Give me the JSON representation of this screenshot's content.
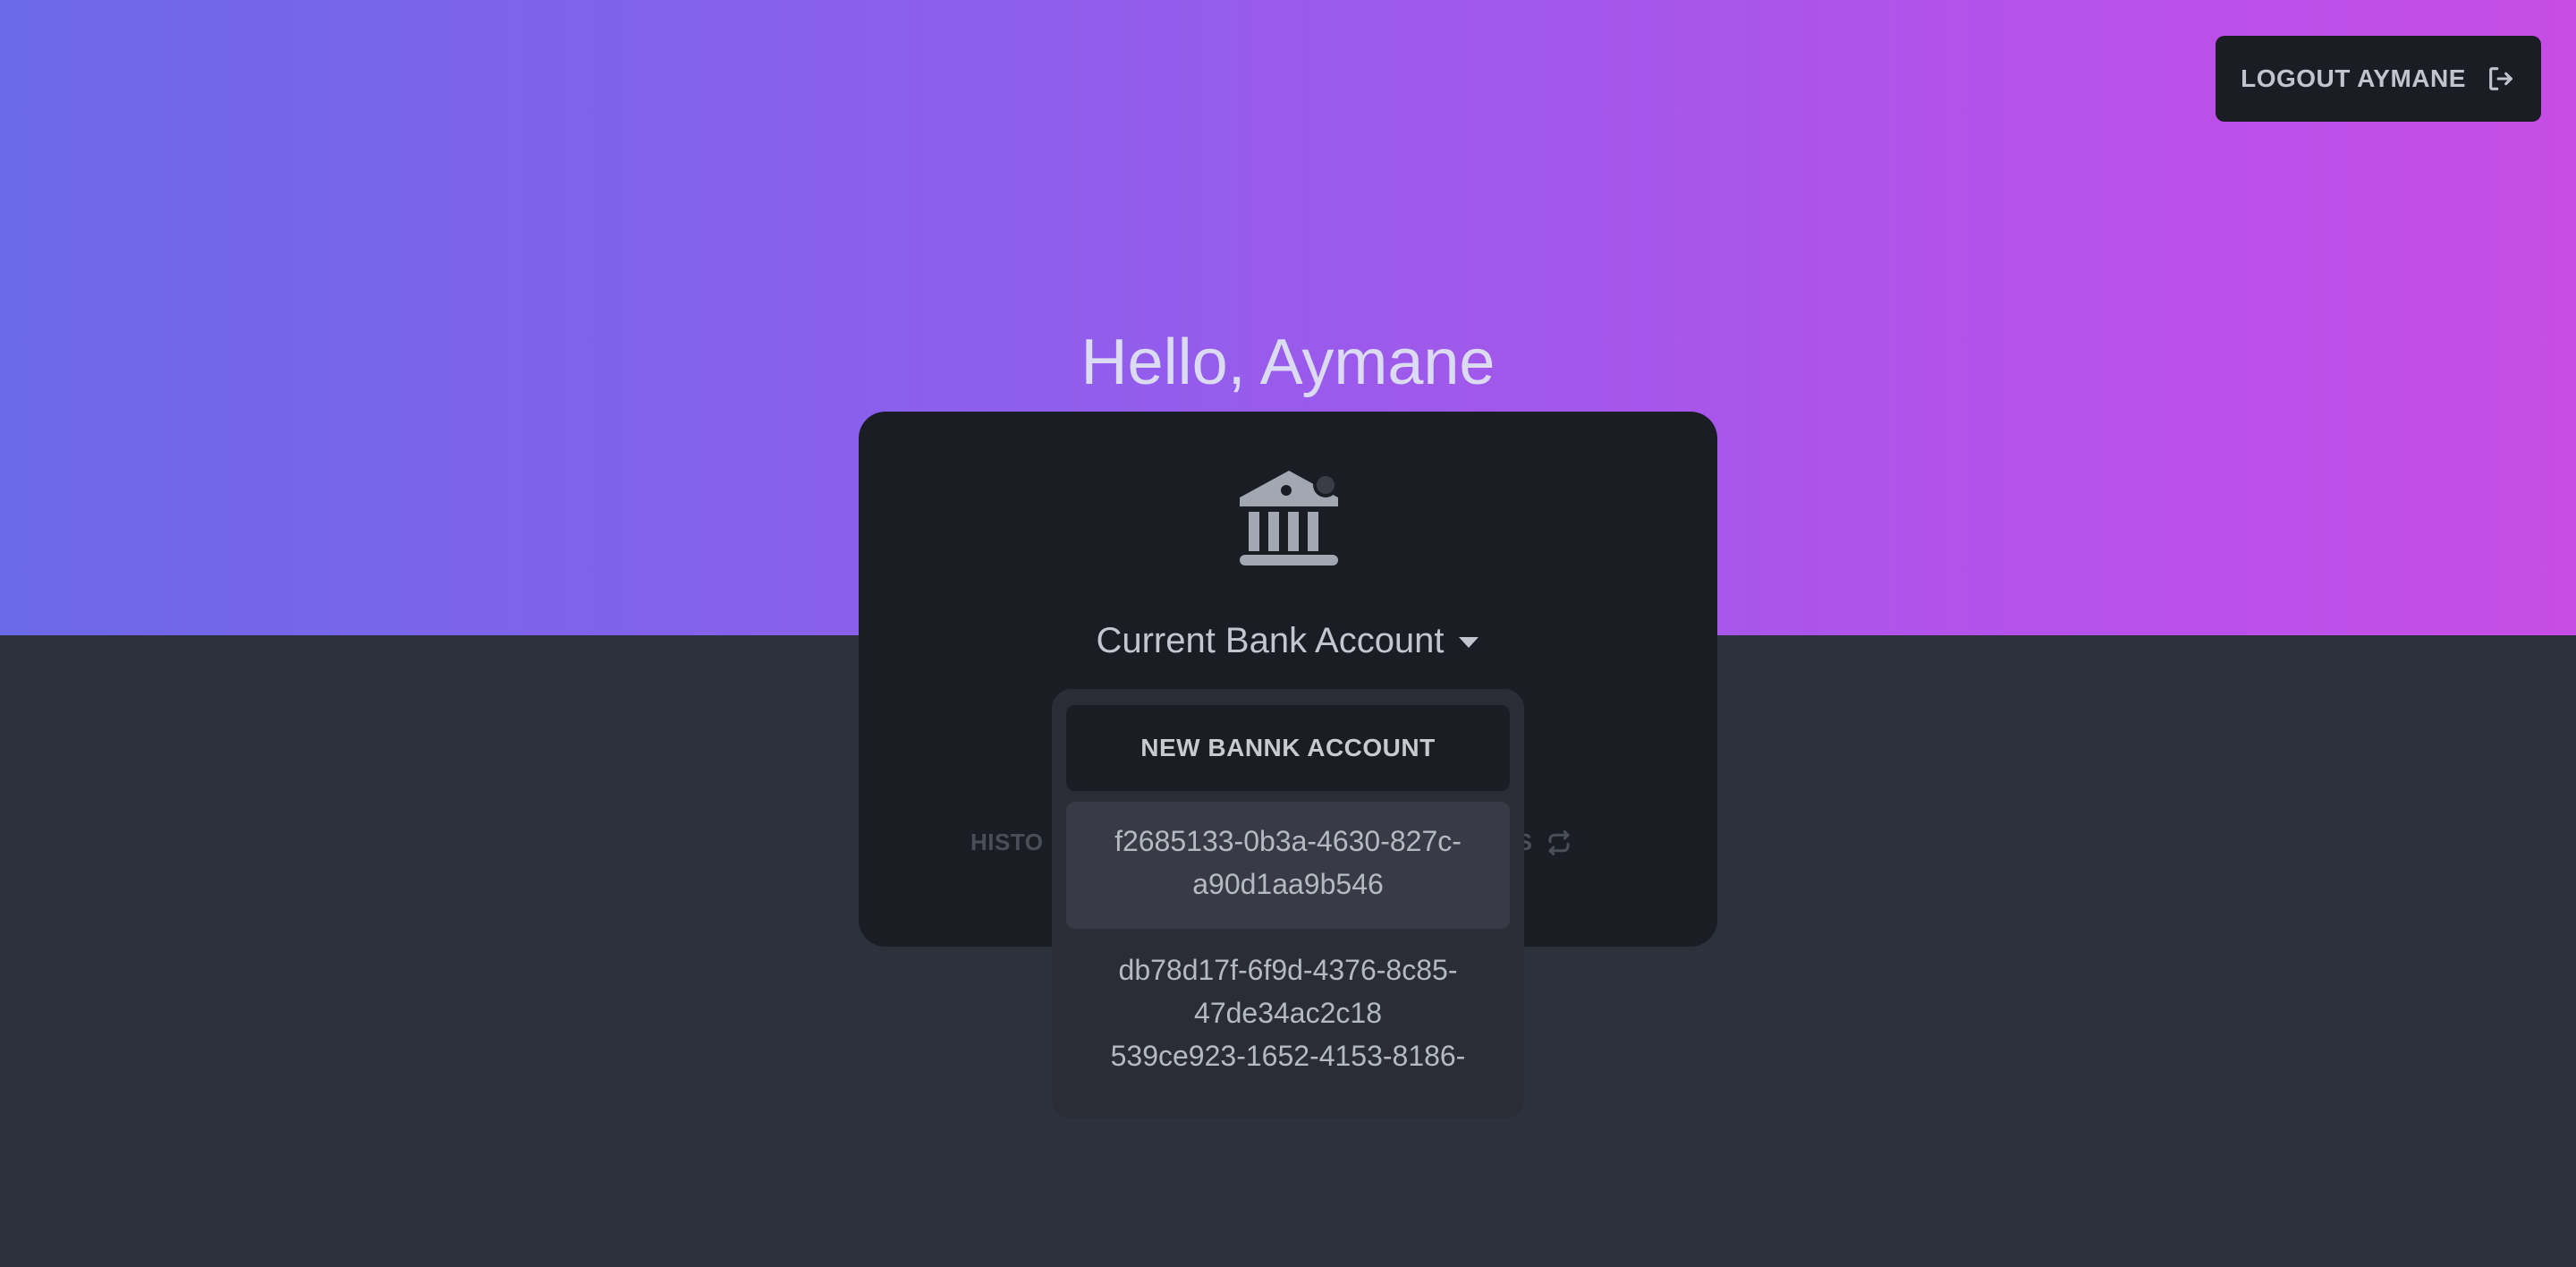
{
  "header": {
    "logout_label": "LOGOUT AYMANE",
    "logout_icon": "sign-out-icon"
  },
  "greeting": "Hello, Aymane",
  "card": {
    "bank_icon": "bank-icon",
    "account_title": "Current Bank Account",
    "caret_icon": "caret-down-icon",
    "history_label": "HISTO",
    "status_label": "TUS",
    "status_icon": "repeat-icon"
  },
  "dropdown": {
    "new_account_label": "NEW BANNK ACCOUNT",
    "accounts": [
      "f2685133-0b3a-4630-827c-a90d1aa9b546",
      "db78d17f-6f9d-4376-8c85-47de34ac2c18",
      "539ce923-1652-4153-8186-"
    ]
  },
  "colors": {
    "gradient_start": "#6b69e8",
    "gradient_end": "#c64de6",
    "page_bg": "#2d313b",
    "card_bg": "#1b1d24",
    "dropdown_bg": "#2a2d36",
    "dropdown_active_bg": "#383b45"
  }
}
